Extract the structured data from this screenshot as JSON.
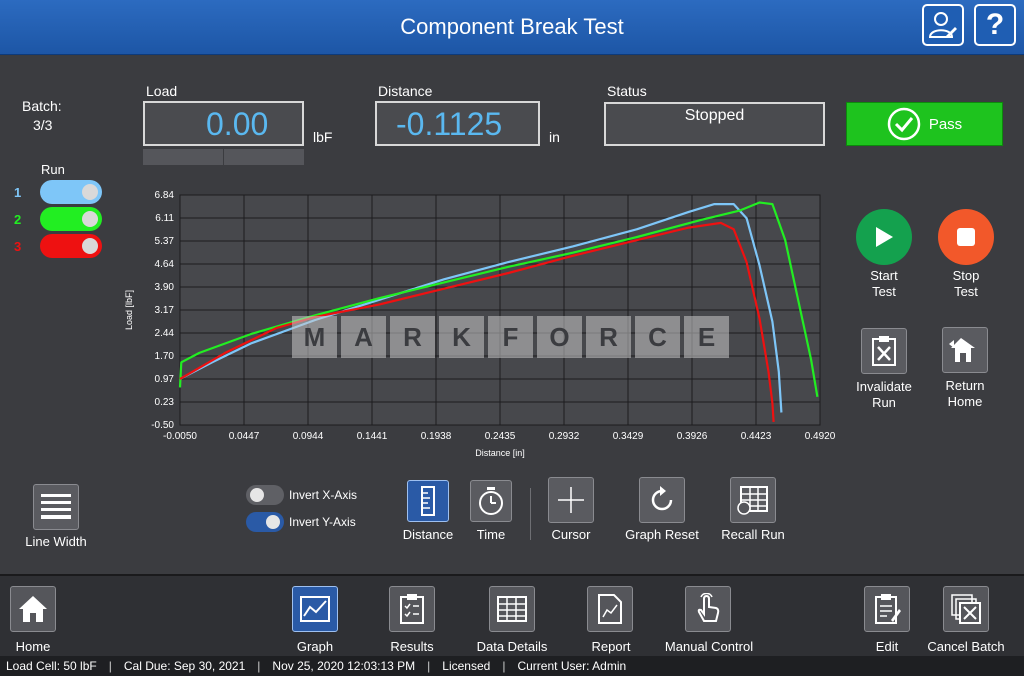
{
  "window": {
    "title": "Component Break Test"
  },
  "batch": {
    "label": "Batch:",
    "value": "3/3"
  },
  "load": {
    "label": "Load",
    "value": "0.00",
    "unit": "lbF"
  },
  "distance": {
    "label": "Distance",
    "value": "-0.1125",
    "unit": "in"
  },
  "status": {
    "label": "Status",
    "value": "Stopped"
  },
  "result": {
    "label": "Pass",
    "color": "#1ec31e"
  },
  "runs": {
    "label": "Run",
    "items": [
      {
        "number": "1",
        "color": "#7ec6f8"
      },
      {
        "number": "2",
        "color": "#22ee22"
      },
      {
        "number": "3",
        "color": "#ee1111"
      }
    ]
  },
  "actions": {
    "start_line1": "Start",
    "start_line2": "Test",
    "stop_line1": "Stop",
    "stop_line2": "Test",
    "invalidate_line1": "Invalidate",
    "invalidate_line2": "Run",
    "return_line1": "Return",
    "return_line2": "Home"
  },
  "toolbar": {
    "line_width": "Line Width",
    "invert_x": "Invert X-Axis",
    "invert_y": "Invert Y-Axis",
    "distance": "Distance",
    "time": "Time",
    "cursor": "Cursor",
    "graph_reset": "Graph Reset",
    "recall_run": "Recall Run"
  },
  "nav": {
    "home": "Home",
    "graph": "Graph",
    "results": "Results",
    "data_details": "Data Details",
    "report": "Report",
    "manual_control": "Manual Control",
    "edit": "Edit",
    "cancel_batch": "Cancel Batch"
  },
  "statusbar": {
    "load_cell": "Load Cell: 50 lbF",
    "cal_due": "Cal Due: Sep 30, 2021",
    "datetime": "Nov 25, 2020 12:03:13 PM",
    "license": "Licensed",
    "user": "Current User: Admin"
  },
  "watermark": "MARKFORCE",
  "chart_data": {
    "type": "line",
    "xlabel": "Distance [in]",
    "ylabel": "Load [lbF]",
    "xlim": [
      -0.005,
      0.492
    ],
    "ylim": [
      -0.5,
      6.84
    ],
    "xticks": [
      "-0.0050",
      "0.0447",
      "0.0944",
      "0.1441",
      "0.1938",
      "0.2435",
      "0.2932",
      "0.3429",
      "0.3926",
      "0.4423",
      "0.4920"
    ],
    "yticks": [
      "6.84",
      "6.11",
      "5.37",
      "4.64",
      "3.90",
      "3.17",
      "2.44",
      "1.70",
      "0.97",
      "0.23",
      "-0.50"
    ],
    "grid": true,
    "series": [
      {
        "color": "#7ec6f8",
        "x": [
          -0.005,
          0.02,
          0.05,
          0.1,
          0.15,
          0.2,
          0.25,
          0.3,
          0.35,
          0.39,
          0.41,
          0.425,
          0.435,
          0.445,
          0.455,
          0.46,
          0.462
        ],
        "y": [
          0.97,
          1.5,
          2.1,
          2.85,
          3.5,
          4.15,
          4.7,
          5.2,
          5.75,
          6.3,
          6.55,
          6.55,
          6.1,
          4.6,
          2.8,
          1.2,
          -0.1
        ]
      },
      {
        "color": "#22ee22",
        "x": [
          -0.005,
          -0.004,
          0.01,
          0.05,
          0.1,
          0.15,
          0.2,
          0.25,
          0.3,
          0.35,
          0.4,
          0.43,
          0.445,
          0.455,
          0.465,
          0.475,
          0.485,
          0.49
        ],
        "y": [
          0.7,
          1.5,
          1.8,
          2.4,
          3.0,
          3.55,
          4.05,
          4.55,
          5.0,
          5.5,
          6.05,
          6.35,
          6.6,
          6.55,
          5.4,
          3.5,
          1.6,
          0.4
        ]
      },
      {
        "color": "#ee1111",
        "x": [
          -0.005,
          0.03,
          0.07,
          0.1,
          0.15,
          0.2,
          0.25,
          0.3,
          0.35,
          0.39,
          0.415,
          0.425,
          0.435,
          0.445,
          0.452,
          0.455,
          0.456
        ],
        "y": [
          0.97,
          1.8,
          2.6,
          2.95,
          3.35,
          3.85,
          4.35,
          4.9,
          5.4,
          5.8,
          5.95,
          5.75,
          4.7,
          2.9,
          1.2,
          0.2,
          -0.4
        ]
      }
    ]
  }
}
